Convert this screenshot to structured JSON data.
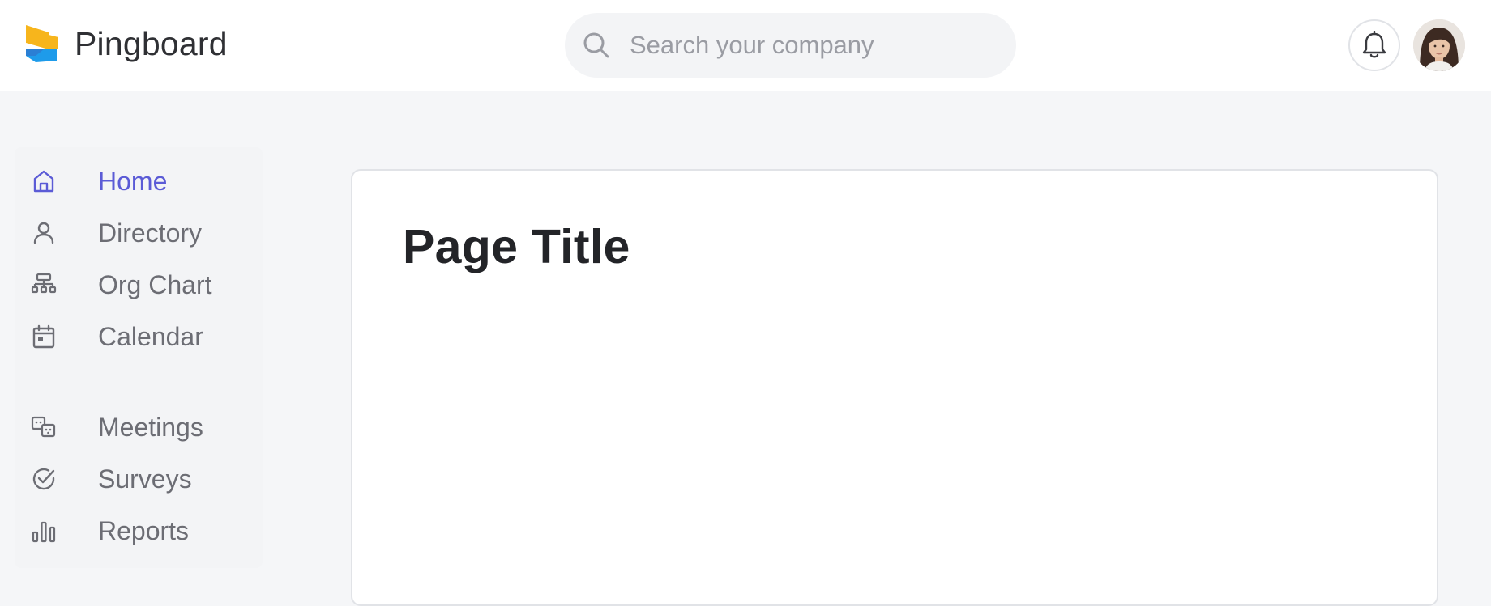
{
  "app": {
    "name": "Pingboard",
    "logo_colors": {
      "top": "#f7b51c",
      "bottom": "#1e9bea"
    },
    "accent": "#5b5bd6"
  },
  "header": {
    "search": {
      "placeholder": "Search your company",
      "value": "",
      "icon": "search-icon"
    },
    "notifications_icon": "bell-icon",
    "avatar": "user-avatar"
  },
  "sidebar": {
    "groups": [
      {
        "items": [
          {
            "label": "Home",
            "icon": "home-icon",
            "active": true
          },
          {
            "label": "Directory",
            "icon": "person-icon",
            "active": false
          },
          {
            "label": "Org Chart",
            "icon": "org-chart-icon",
            "active": false
          },
          {
            "label": "Calendar",
            "icon": "calendar-icon",
            "active": false
          }
        ]
      },
      {
        "items": [
          {
            "label": "Meetings",
            "icon": "meetings-icon",
            "active": false
          },
          {
            "label": "Surveys",
            "icon": "check-circle-icon",
            "active": false
          },
          {
            "label": "Reports",
            "icon": "bar-chart-icon",
            "active": false
          }
        ]
      }
    ]
  },
  "main": {
    "title": "Page Title"
  }
}
